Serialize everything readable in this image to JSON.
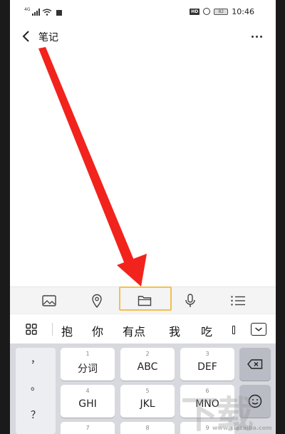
{
  "status_bar": {
    "network_tag": "4G",
    "hd_badge": "HD",
    "battery": "82",
    "time": "10:46"
  },
  "header": {
    "title": "笔记"
  },
  "toolbar": {
    "icons": [
      "image-icon",
      "location-icon",
      "folder-icon",
      "microphone-icon",
      "checklist-icon"
    ],
    "highlight_color": "#f2c14e"
  },
  "candidates": {
    "items": [
      "抱",
      "你",
      "有点",
      "我",
      "吃"
    ]
  },
  "keyboard": {
    "punctuation": [
      "，",
      "。",
      "？"
    ],
    "keys": [
      {
        "num": "1",
        "label": "分词"
      },
      {
        "num": "2",
        "label": "ABC"
      },
      {
        "num": "3",
        "label": "DEF"
      },
      {
        "num": "4",
        "label": "GHI"
      },
      {
        "num": "5",
        "label": "JKL"
      },
      {
        "num": "6",
        "label": "MNO"
      },
      {
        "num": "7",
        "label": ""
      },
      {
        "num": "8",
        "label": ""
      },
      {
        "num": "9",
        "label": ""
      }
    ]
  },
  "annotation": {
    "arrow_color": "#f2231c"
  },
  "watermark": {
    "brand": "下载",
    "url": "www.xiazaiba.com"
  }
}
